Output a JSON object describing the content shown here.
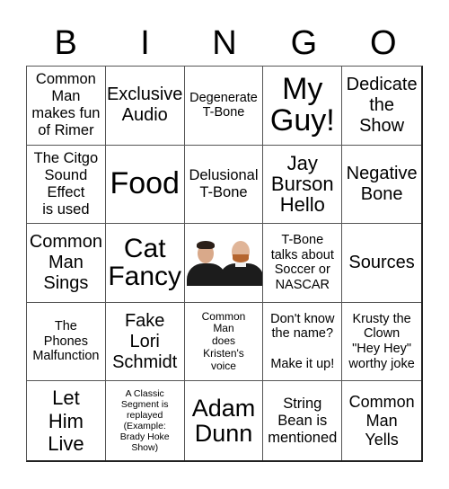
{
  "header": {
    "letters": [
      "B",
      "I",
      "N",
      "G",
      "O"
    ]
  },
  "cells": [
    "Common\nMan\nmakes fun\nof Rimer",
    "Exclusive\nAudio",
    "Degenerate\nT-Bone",
    "My\nGuy!",
    "Dedicate\nthe\nShow",
    "The Citgo\nSound\nEffect\nis used",
    "Food",
    "Delusional\nT-Bone",
    "Jay\nBurson\nHello",
    "Negative\nBone",
    "Common\nMan\nSings",
    "Cat\nFancy",
    "[free-space-photo]",
    "T-Bone\ntalks about\nSoccer or\nNASCAR",
    "Sources",
    "The\nPhones\nMalfunction",
    "Fake\nLori\nSchmidt",
    "Common\nMan\ndoes\nKristen's\nvoice",
    "Don't know\nthe name?\n\nMake it up!",
    "Krusty the\nClown\n\"Hey Hey\"\nworthy joke",
    "Let\nHim\nLive",
    "A Classic\nSegment is\nreplayed\n(Example:\nBrady Hoke\nShow)",
    "Adam\nDunn",
    "String\nBean is\nmentioned",
    "Common\nMan\nYells"
  ],
  "free_space": {
    "image_description": "photo of two smiling men in black shirts"
  }
}
